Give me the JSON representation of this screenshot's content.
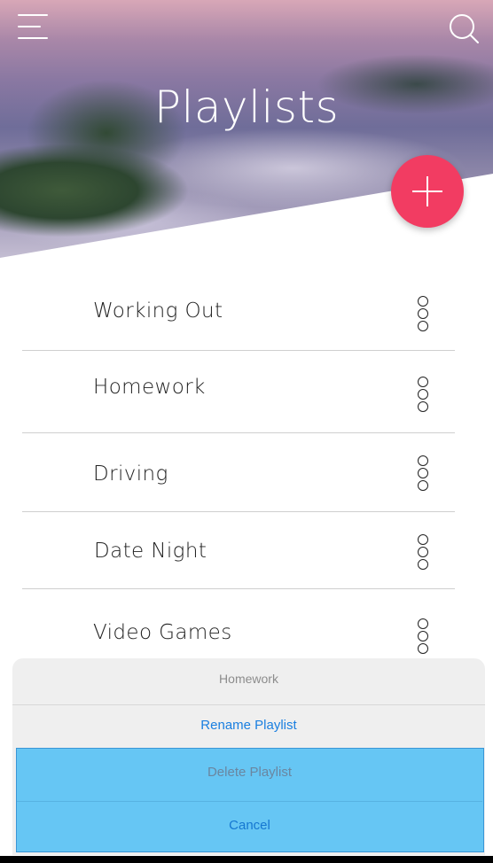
{
  "header": {
    "title": "Playlists",
    "menu_icon": "hamburger-menu-icon",
    "search_icon": "search-icon",
    "add_button_icon": "plus-icon",
    "add_button_color": "#f23c62"
  },
  "playlists": [
    {
      "label": "Working Out"
    },
    {
      "label": "Homework"
    },
    {
      "label": "Driving"
    },
    {
      "label": "Date Night"
    },
    {
      "label": "Video Games"
    }
  ],
  "action_sheet": {
    "title": "Homework",
    "rename_label": "Rename Playlist",
    "delete_label": "Delete Playlist",
    "cancel_label": "Cancel",
    "action_color": "#1a7fe0",
    "highlight_color": "#66c6f4"
  }
}
